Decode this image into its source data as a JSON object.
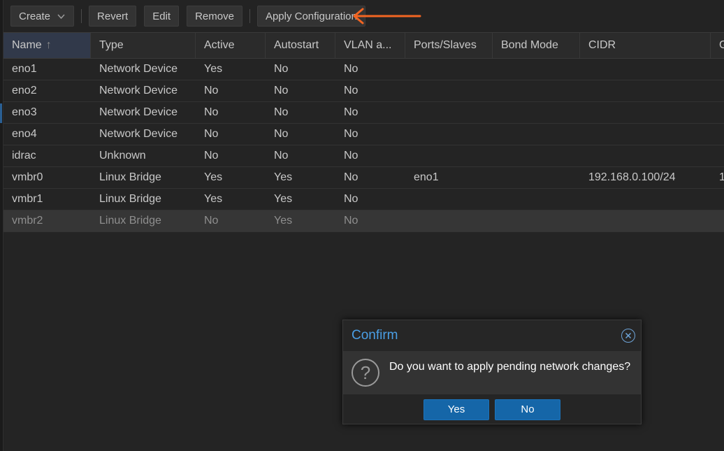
{
  "toolbar": {
    "create_label": "Create",
    "revert_label": "Revert",
    "edit_label": "Edit",
    "remove_label": "Remove",
    "apply_label": "Apply Configuration"
  },
  "grid": {
    "columns": [
      "Name",
      "Type",
      "Active",
      "Autostart",
      "VLAN a...",
      "Ports/Slaves",
      "Bond Mode",
      "CIDR",
      "G"
    ],
    "sort_indicator": "↑",
    "rows": [
      {
        "name": "eno1",
        "type": "Network Device",
        "active": "Yes",
        "autostart": "No",
        "vlan": "No",
        "ports": "",
        "bond": "",
        "cidr": "",
        "extra": ""
      },
      {
        "name": "eno2",
        "type": "Network Device",
        "active": "No",
        "autostart": "No",
        "vlan": "No",
        "ports": "",
        "bond": "",
        "cidr": "",
        "extra": ""
      },
      {
        "name": "eno3",
        "type": "Network Device",
        "active": "No",
        "autostart": "No",
        "vlan": "No",
        "ports": "",
        "bond": "",
        "cidr": "",
        "extra": ""
      },
      {
        "name": "eno4",
        "type": "Network Device",
        "active": "No",
        "autostart": "No",
        "vlan": "No",
        "ports": "",
        "bond": "",
        "cidr": "",
        "extra": ""
      },
      {
        "name": "idrac",
        "type": "Unknown",
        "active": "No",
        "autostart": "No",
        "vlan": "No",
        "ports": "",
        "bond": "",
        "cidr": "",
        "extra": ""
      },
      {
        "name": "vmbr0",
        "type": "Linux Bridge",
        "active": "Yes",
        "autostart": "Yes",
        "vlan": "No",
        "ports": "eno1",
        "bond": "",
        "cidr": "192.168.0.100/24",
        "extra": "1"
      },
      {
        "name": "vmbr1",
        "type": "Linux Bridge",
        "active": "Yes",
        "autostart": "Yes",
        "vlan": "No",
        "ports": "",
        "bond": "",
        "cidr": "",
        "extra": ""
      },
      {
        "name": "vmbr2",
        "type": "Linux Bridge",
        "active": "No",
        "autostart": "Yes",
        "vlan": "No",
        "ports": "",
        "bond": "",
        "cidr": "",
        "extra": ""
      }
    ],
    "selected_row": "vmbr2"
  },
  "dialog": {
    "title": "Confirm",
    "question_glyph": "?",
    "message": "Do you want to apply pending network changes?",
    "yes_label": "Yes",
    "no_label": "No"
  },
  "colors": {
    "annotation_arrow": "#f26522",
    "dialog_title": "#4a9fe6",
    "primary_button": "#1566a8"
  },
  "icons": {
    "create_dropdown": "chevron-down-icon",
    "dialog_close": "close-circle-icon",
    "dialog_question": "question-icon",
    "annotation": "arrow-left-icon"
  }
}
